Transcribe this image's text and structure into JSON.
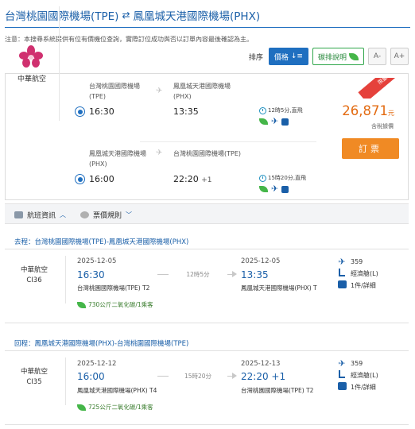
{
  "header": {
    "origin": "台灣桃園國際機場(TPE)",
    "swap_icon": "⇄",
    "destination": "鳳凰城天港國際機場(PHX)"
  },
  "notice": "注意：本搜尋系統提供有位有價機位查詢，實際訂位成功與否以訂單內容最後確認為主。",
  "sortbar": {
    "label": "排序",
    "price_button": "價格",
    "promo_button": "碳排說明",
    "font_small": "A-",
    "font_large": "A+"
  },
  "result": {
    "ribbon": "限量特惠",
    "airline": "中華航空",
    "outbound": {
      "from": "台灣桃園國際機場",
      "from_code": "(TPE)",
      "to": "鳳凰城天港國際機場",
      "to_code": "(PHX)",
      "depart": "16:30",
      "arrive": "13:35",
      "duration": "12時5分,直飛"
    },
    "inbound": {
      "from": "鳳凰城天港國際機場",
      "from_code": "(PHX)",
      "to": "台灣桃園國際機場(TPE)",
      "depart": "16:00",
      "arrive": "22:20",
      "plus": "+1",
      "duration": "15時20分,直飛"
    },
    "price": "26,871",
    "price_unit": "元",
    "price_note": "含稅據價",
    "book_button": "訂票"
  },
  "tabs": {
    "flight_info": "航班資訊",
    "fare_rules": "票價規則"
  },
  "segments": [
    {
      "title": "去程：台灣桃園國際機場(TPE)-鳳凰城天港國際機場(PHX)",
      "airline": "中華航空",
      "flight_no": "CI36",
      "dep_date": "2025-12-05",
      "dep_time": "16:30",
      "dep_airport": "台灣桃園國際機場(TPE) T2",
      "duration": "12時5分",
      "arr_date": "2025-12-05",
      "arr_time": "13:35",
      "arr_airport": "鳳凰城天港國際機場(PHX) T",
      "co2": "730公斤二氧化碳/1乘客",
      "aircraft": "359",
      "cabin": "經濟艙(L)",
      "baggage": "1件/詳細"
    },
    {
      "title": "回程：鳳凰城天港國際機場(PHX)-台灣桃園國際機場(TPE)",
      "airline": "中華航空",
      "flight_no": "CI35",
      "dep_date": "2025-12-12",
      "dep_time": "16:00",
      "dep_airport": "鳳凰城天港國際機場(PHX) T4",
      "duration": "15時20分",
      "arr_date": "2025-12-13",
      "arr_time": "22:20 +1",
      "arr_airport": "台灣桃園國際機場(TPE) T2",
      "co2": "725公斤二氧化碳/1乘客",
      "aircraft": "359",
      "cabin": "經濟艙(L)",
      "baggage": "1件/詳細"
    }
  ]
}
